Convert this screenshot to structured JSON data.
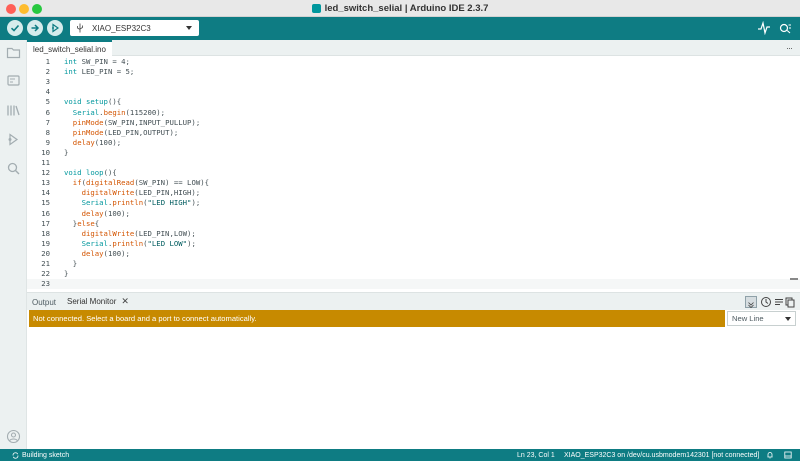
{
  "window": {
    "title": "led_switch_selial | Arduino IDE 2.3.7"
  },
  "toolbar": {
    "board": "XIAO_ESP32C3"
  },
  "tabs": {
    "file": "led_switch_selial.ino",
    "more": "···"
  },
  "code": {
    "lines": [
      {
        "n": "1",
        "parts": [
          [
            "type",
            "int"
          ],
          [
            "plain",
            " SW_PIN = 4;"
          ]
        ]
      },
      {
        "n": "2",
        "parts": [
          [
            "type",
            "int"
          ],
          [
            "plain",
            " LED_PIN = 5;"
          ]
        ]
      },
      {
        "n": "3",
        "parts": []
      },
      {
        "n": "4",
        "parts": []
      },
      {
        "n": "5",
        "parts": [
          [
            "type",
            "void"
          ],
          [
            "plain",
            " "
          ],
          [
            "type",
            "setup"
          ],
          [
            "plain",
            "(){"
          ]
        ]
      },
      {
        "n": "6",
        "parts": [
          [
            "plain",
            "  "
          ],
          [
            "type",
            "Serial"
          ],
          [
            "plain",
            "."
          ],
          [
            "fn",
            "begin"
          ],
          [
            "plain",
            "(115200);"
          ]
        ]
      },
      {
        "n": "7",
        "parts": [
          [
            "plain",
            "  "
          ],
          [
            "fn",
            "pinMode"
          ],
          [
            "plain",
            "(SW_PIN,INPUT_PULLUP);"
          ]
        ]
      },
      {
        "n": "8",
        "parts": [
          [
            "plain",
            "  "
          ],
          [
            "fn",
            "pinMode"
          ],
          [
            "plain",
            "(LED_PIN,OUTPUT);"
          ]
        ]
      },
      {
        "n": "9",
        "parts": [
          [
            "plain",
            "  "
          ],
          [
            "fn",
            "delay"
          ],
          [
            "plain",
            "(100);"
          ]
        ]
      },
      {
        "n": "10",
        "parts": [
          [
            "plain",
            "}"
          ]
        ]
      },
      {
        "n": "11",
        "parts": []
      },
      {
        "n": "12",
        "parts": [
          [
            "type",
            "void"
          ],
          [
            "plain",
            " "
          ],
          [
            "type",
            "loop"
          ],
          [
            "plain",
            "(){"
          ]
        ]
      },
      {
        "n": "13",
        "parts": [
          [
            "plain",
            "  "
          ],
          [
            "fn",
            "if"
          ],
          [
            "plain",
            "("
          ],
          [
            "fn",
            "digitalRead"
          ],
          [
            "plain",
            "(SW_PIN) == LOW){"
          ]
        ]
      },
      {
        "n": "14",
        "parts": [
          [
            "plain",
            "    "
          ],
          [
            "fn",
            "digitalWrite"
          ],
          [
            "plain",
            "(LED_PIN,HIGH);"
          ]
        ]
      },
      {
        "n": "15",
        "parts": [
          [
            "plain",
            "    "
          ],
          [
            "type",
            "Serial"
          ],
          [
            "plain",
            "."
          ],
          [
            "fn",
            "println"
          ],
          [
            "plain",
            "("
          ],
          [
            "str",
            "\"LED HIGH\""
          ],
          [
            "plain",
            ");"
          ]
        ]
      },
      {
        "n": "16",
        "parts": [
          [
            "plain",
            "    "
          ],
          [
            "fn",
            "delay"
          ],
          [
            "plain",
            "(100);"
          ]
        ]
      },
      {
        "n": "17",
        "parts": [
          [
            "plain",
            "  }"
          ],
          [
            "fn",
            "else"
          ],
          [
            "plain",
            "{"
          ]
        ]
      },
      {
        "n": "18",
        "parts": [
          [
            "plain",
            "    "
          ],
          [
            "fn",
            "digitalWrite"
          ],
          [
            "plain",
            "(LED_PIN,LOW);"
          ]
        ]
      },
      {
        "n": "19",
        "parts": [
          [
            "plain",
            "    "
          ],
          [
            "type",
            "Serial"
          ],
          [
            "plain",
            "."
          ],
          [
            "fn",
            "println"
          ],
          [
            "plain",
            "("
          ],
          [
            "str",
            "\"LED LOW\""
          ],
          [
            "plain",
            ");"
          ]
        ]
      },
      {
        "n": "20",
        "parts": [
          [
            "plain",
            "    "
          ],
          [
            "fn",
            "delay"
          ],
          [
            "plain",
            "(100);"
          ]
        ]
      },
      {
        "n": "21",
        "parts": [
          [
            "plain",
            "  }"
          ]
        ]
      },
      {
        "n": "22",
        "parts": [
          [
            "plain",
            "}"
          ]
        ]
      },
      {
        "n": "23",
        "parts": []
      }
    ]
  },
  "panel": {
    "output_tab": "Output",
    "serial_tab": "Serial Monitor",
    "close": "✕",
    "warning": "Not connected. Select a board and a port to connect automatically.",
    "line_ending": "New Line"
  },
  "status": {
    "building": "Building sketch",
    "position": "Ln 23, Col 1",
    "connection": "XIAO_ESP32C3 on /dev/cu.usbmodem142301 [not connected]"
  },
  "icons": {
    "verify": "check-icon",
    "upload": "arrow-right-icon",
    "debug": "debugger-icon",
    "serial_plotter": "pulse-icon",
    "serial_monitor": "magnifier-icon",
    "sidebar": [
      "folder-icon",
      "board-icon",
      "library-icon",
      "debug-icon",
      "search-icon",
      "account-icon"
    ]
  },
  "colors": {
    "accent": "#0e7c83",
    "warning": "#c78a00",
    "keyword": "#00979d",
    "function": "#d35400"
  }
}
